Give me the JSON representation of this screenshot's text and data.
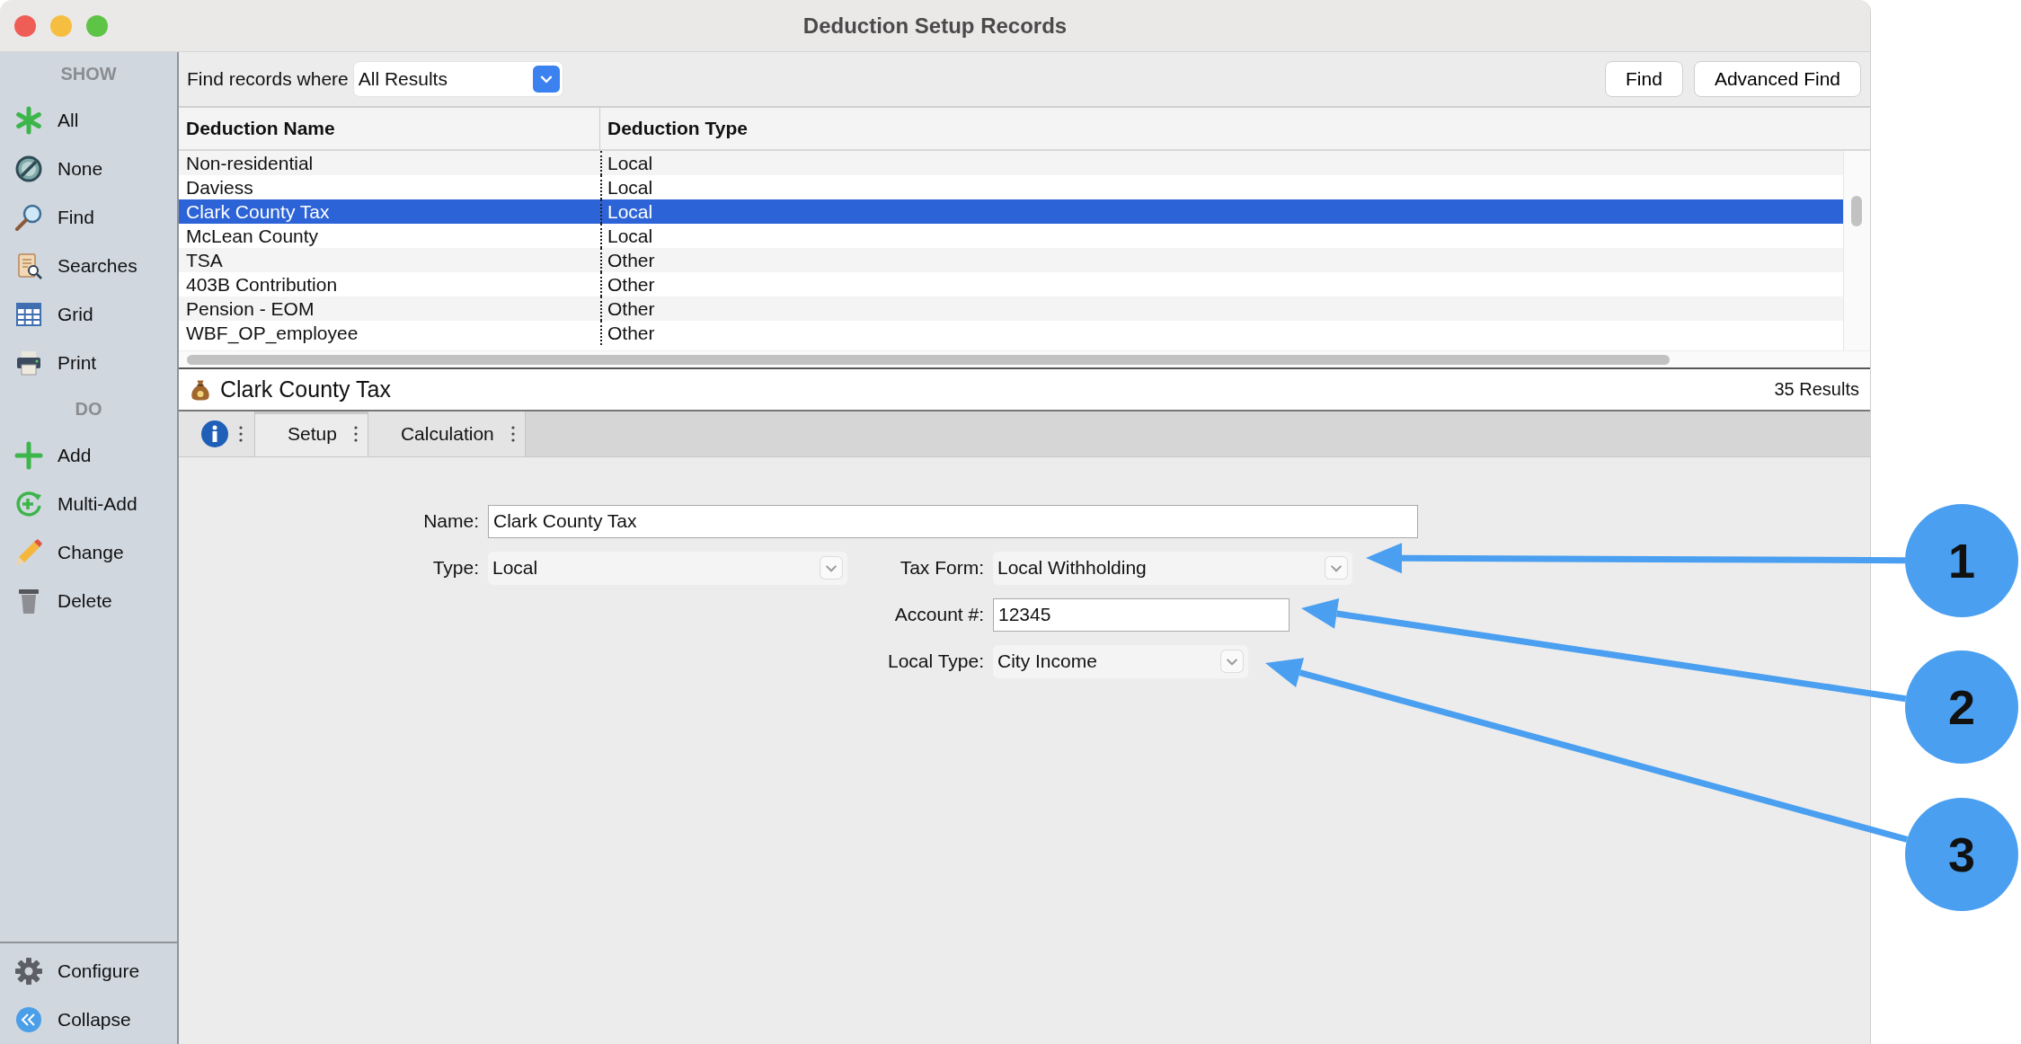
{
  "window": {
    "title": "Deduction Setup Records"
  },
  "sidebar": {
    "sections": [
      {
        "heading": "SHOW",
        "items": [
          {
            "label": "All"
          },
          {
            "label": "None"
          },
          {
            "label": "Find"
          },
          {
            "label": "Searches"
          },
          {
            "label": "Grid"
          },
          {
            "label": "Print"
          }
        ]
      },
      {
        "heading": "DO",
        "items": [
          {
            "label": "Add"
          },
          {
            "label": "Multi-Add"
          },
          {
            "label": "Change"
          },
          {
            "label": "Delete"
          }
        ]
      }
    ],
    "footer_items": [
      {
        "label": "Configure"
      },
      {
        "label": "Collapse"
      }
    ]
  },
  "find_bar": {
    "label": "Find records where",
    "select": {
      "value": "All Results"
    },
    "buttons": [
      "Find",
      "Advanced Find"
    ]
  },
  "table": {
    "columns": [
      "Deduction Name",
      "Deduction Type"
    ],
    "rows": [
      {
        "cells": [
          "Non-residential",
          "Local"
        ],
        "selected": false
      },
      {
        "cells": [
          "Daviess",
          "Local"
        ],
        "selected": false
      },
      {
        "cells": [
          "Clark County Tax",
          "Local"
        ],
        "selected": true
      },
      {
        "cells": [
          "McLean County",
          "Local"
        ],
        "selected": false
      },
      {
        "cells": [
          "TSA",
          "Other"
        ],
        "selected": false
      },
      {
        "cells": [
          "403B Contribution",
          "Other"
        ],
        "selected": false
      },
      {
        "cells": [
          "Pension - EOM",
          "Other"
        ],
        "selected": false
      },
      {
        "cells": [
          "WBF_OP_employee",
          "Other"
        ],
        "selected": false
      }
    ]
  },
  "record_bar": {
    "title": "Clark County Tax",
    "count": "35 Results"
  },
  "tabs": [
    {
      "label": "Setup",
      "selected": true
    },
    {
      "label": "Calculation",
      "selected": false
    }
  ],
  "form": {
    "rows": [
      [
        {
          "label": "Name:",
          "value": "Clark County Tax",
          "kind": "text"
        }
      ],
      [
        {
          "label": "Type:",
          "value": "Local",
          "kind": "select"
        },
        {
          "label": "Tax Form:",
          "value": "Local Withholding",
          "kind": "select"
        }
      ],
      [
        {
          "label": "Account #:",
          "value": "12345",
          "kind": "text"
        }
      ],
      [
        {
          "label": "Local Type:",
          "value": "City Income",
          "kind": "select"
        }
      ]
    ]
  },
  "callouts": [
    {
      "number": "1"
    },
    {
      "number": "2"
    },
    {
      "number": "3"
    }
  ]
}
